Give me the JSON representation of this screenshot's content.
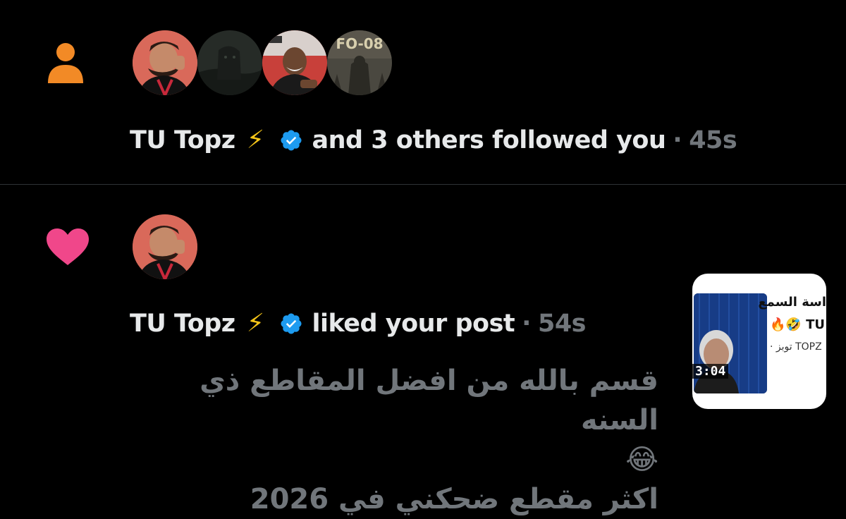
{
  "notifications": [
    {
      "type": "follow",
      "icon": "person-icon",
      "avatars": [
        "tu-topz",
        "dark-figure",
        "event-host",
        "fo-08-poster"
      ],
      "fo_label": "FO-08",
      "name": "TU Topz",
      "bolt": "⚡",
      "action": "and 3 others followed you",
      "separator": "·",
      "time": "45s"
    },
    {
      "type": "like",
      "icon": "heart-icon",
      "name": "TU Topz",
      "bolt": "⚡",
      "action": "liked your post",
      "separator": "·",
      "time": "54s",
      "post_lines": [
        "قسم بالله من افضل المقاطع ذي السنه",
        "😂",
        "اكثر مقطع ضحكني في 2026"
      ],
      "embed": {
        "title": "اسة السمع",
        "subtitle": "🔥🤣 TU",
        "channel": "TOPZ توبز ·",
        "duration": "3:04"
      }
    }
  ],
  "colors": {
    "background": "#000000",
    "text": "#e7e9ea",
    "muted": "#71767b",
    "verified": "#1d9bf0",
    "follow_icon": "#f28a26",
    "like_icon": "#f0478a",
    "divider": "#2f3336"
  }
}
